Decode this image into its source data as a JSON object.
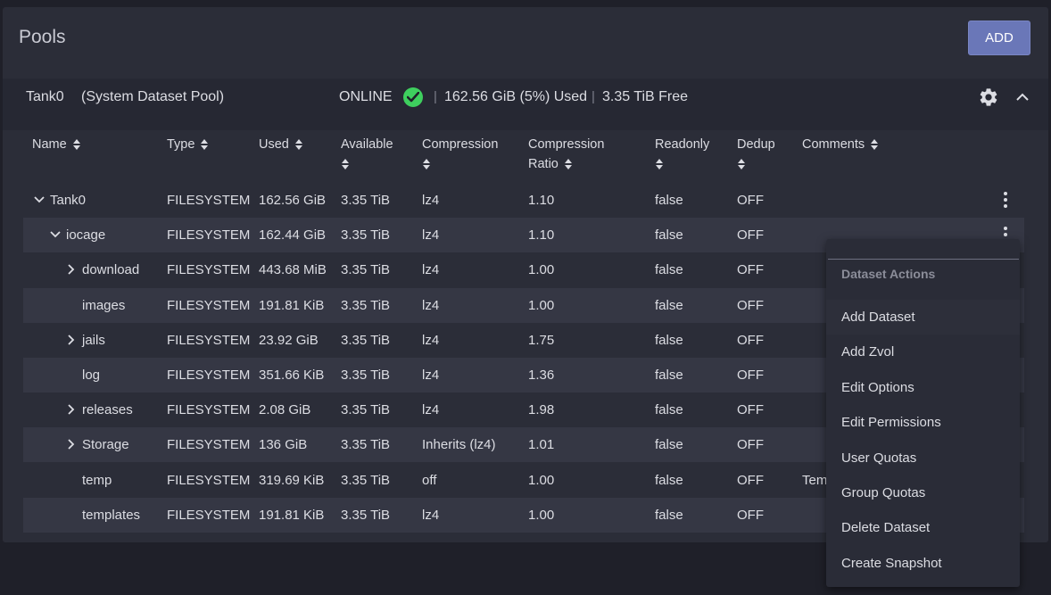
{
  "page": {
    "title": "Pools",
    "add_label": "ADD"
  },
  "pool": {
    "name": "Tank0",
    "subtitle": "(System Dataset Pool)",
    "status": "ONLINE",
    "status_icon": "check-circle-icon",
    "status_color": "#3ecf5e",
    "separator": "|",
    "used": "162.56 GiB (5%) Used",
    "free": "3.35 TiB Free"
  },
  "table": {
    "columns": [
      {
        "line1": "Name",
        "line2": ""
      },
      {
        "line1": "Type",
        "line2": ""
      },
      {
        "line1": "Used",
        "line2": ""
      },
      {
        "line1": "Available",
        "line2": ""
      },
      {
        "line1": "Compression",
        "line2": ""
      },
      {
        "line1": "Compression",
        "line2": "Ratio"
      },
      {
        "line1": "Readonly",
        "line2": ""
      },
      {
        "line1": "Dedup",
        "line2": ""
      },
      {
        "line1": "Comments",
        "line2": ""
      }
    ],
    "rows": [
      {
        "name": "Tank0",
        "expander": "chevron-down",
        "type": "FILESYSTEM",
        "used": "162.56 GiB",
        "available": "3.35 TiB",
        "compression": "lz4",
        "ratio": "1.10",
        "readonly": "false",
        "dedup": "OFF",
        "comments": ""
      },
      {
        "name": "iocage",
        "expander": "chevron-down",
        "type": "FILESYSTEM",
        "used": "162.44 GiB",
        "available": "3.35 TiB",
        "compression": "lz4",
        "ratio": "1.10",
        "readonly": "false",
        "dedup": "OFF",
        "comments": ""
      },
      {
        "name": "download",
        "expander": "chevron-right",
        "type": "FILESYSTEM",
        "used": "443.68 MiB",
        "available": "3.35 TiB",
        "compression": "lz4",
        "ratio": "1.00",
        "readonly": "false",
        "dedup": "OFF",
        "comments": ""
      },
      {
        "name": "images",
        "expander": "",
        "type": "FILESYSTEM",
        "used": "191.81 KiB",
        "available": "3.35 TiB",
        "compression": "lz4",
        "ratio": "1.00",
        "readonly": "false",
        "dedup": "OFF",
        "comments": ""
      },
      {
        "name": "jails",
        "expander": "chevron-right",
        "type": "FILESYSTEM",
        "used": "23.92 GiB",
        "available": "3.35 TiB",
        "compression": "lz4",
        "ratio": "1.75",
        "readonly": "false",
        "dedup": "OFF",
        "comments": ""
      },
      {
        "name": "log",
        "expander": "",
        "type": "FILESYSTEM",
        "used": "351.66 KiB",
        "available": "3.35 TiB",
        "compression": "lz4",
        "ratio": "1.36",
        "readonly": "false",
        "dedup": "OFF",
        "comments": ""
      },
      {
        "name": "releases",
        "expander": "chevron-right",
        "type": "FILESYSTEM",
        "used": "2.08 GiB",
        "available": "3.35 TiB",
        "compression": "lz4",
        "ratio": "1.98",
        "readonly": "false",
        "dedup": "OFF",
        "comments": ""
      },
      {
        "name": "Storage",
        "expander": "chevron-right",
        "type": "FILESYSTEM",
        "used": "136 GiB",
        "available": "3.35 TiB",
        "compression": "Inherits (lz4)",
        "ratio": "1.01",
        "readonly": "false",
        "dedup": "OFF",
        "comments": ""
      },
      {
        "name": "temp",
        "expander": "",
        "type": "FILESYSTEM",
        "used": "319.69 KiB",
        "available": "3.35 TiB",
        "compression": "off",
        "ratio": "1.00",
        "readonly": "false",
        "dedup": "OFF",
        "comments": "Tem"
      },
      {
        "name": "templates",
        "expander": "",
        "type": "FILESYSTEM",
        "used": "191.81 KiB",
        "available": "3.35 TiB",
        "compression": "lz4",
        "ratio": "1.00",
        "readonly": "false",
        "dedup": "OFF",
        "comments": ""
      }
    ]
  },
  "menu": {
    "header": "Dataset Actions",
    "items": [
      {
        "label": "Add Dataset"
      },
      {
        "label": "Add Zvol"
      },
      {
        "label": "Edit Options"
      },
      {
        "label": "Edit Permissions"
      },
      {
        "label": "User Quotas"
      },
      {
        "label": "Group Quotas"
      },
      {
        "label": "Delete Dataset"
      },
      {
        "label": "Create Snapshot"
      }
    ]
  }
}
